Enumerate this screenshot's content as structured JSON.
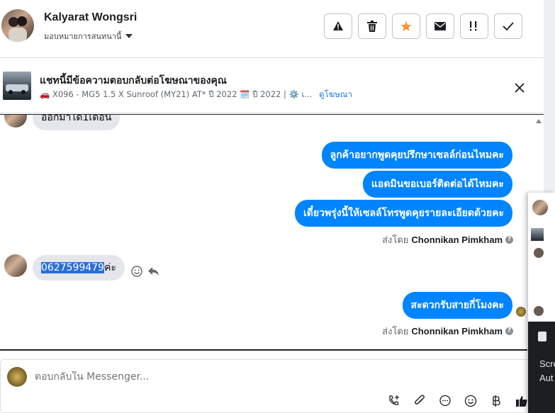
{
  "header": {
    "name": "Kalyarat Wongsri",
    "assignee": "มอบหมายการสนทนานี้"
  },
  "toolbar": {
    "buttons": [
      {
        "name": "report-button",
        "icon": "warning-icon"
      },
      {
        "name": "delete-button",
        "icon": "trash-icon"
      },
      {
        "name": "star-button",
        "icon": "star-icon"
      },
      {
        "name": "mark-unread-button",
        "icon": "envelope-icon"
      },
      {
        "name": "follow-up-button",
        "icon": "flag-exclaim-icon"
      },
      {
        "name": "done-button",
        "icon": "check-icon"
      }
    ],
    "star_color": "#f7923b"
  },
  "ad": {
    "title": "แชทนี้มีข้อความตอบกลับต่อโฆษณาของคุณ",
    "desc_prefix": "🚗 X096 - MG5 1.5 X Sunroof (MY21) AT* ปี 2022 🗓️ ปี 2022 | ⚙️ เ...",
    "link": "ดูโฆษณา"
  },
  "messages": {
    "incoming_top": "ออกมาได้1เดือน",
    "out_1": "ลูกค้าอยากพูดคุยปรึกษาเซลล์ก่อนไหมคะ",
    "out_2": "แอดมินขอเบอร์ติดต่อได้ไหมคะ",
    "out_3": "เดี๋ยวพรุ่งนี้ให้เซลล์โทรพูดคุยรายละเอียดด้วยคะ",
    "sent_by_label": "ส่งโดย",
    "sent_by_name": "Chonnikan Pimkham",
    "incoming_phone": "0627599479",
    "incoming_suffix": "ค่ะ",
    "out_4": "สะดวกรับสายกี่โมงคะ",
    "sent_by_label_2": "ส่งโดย",
    "sent_by_name_2": "Chonnikan Pimkham"
  },
  "composer": {
    "placeholder": "ตอบกลับใน Messenger..."
  },
  "side_panel": {
    "line1": "Scre",
    "line2": "Aut"
  },
  "colors": {
    "accent": "#0084ff",
    "bubble_in": "#e4e6eb"
  }
}
